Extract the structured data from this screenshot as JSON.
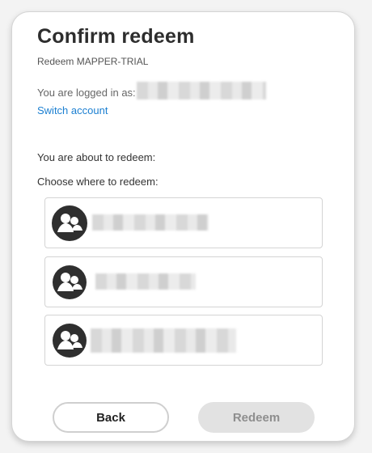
{
  "dialog": {
    "title": "Confirm redeem",
    "subtitle": "Redeem MAPPER-TRIAL"
  },
  "account": {
    "logged_in_label": "You are logged in as:",
    "switch_label": "Switch account"
  },
  "redeem": {
    "about_label": "You are about to redeem:",
    "choose_label": "Choose where to redeem:",
    "options": [
      {
        "icon": "group-avatar-icon"
      },
      {
        "icon": "group-avatar-icon"
      },
      {
        "icon": "group-avatar-icon"
      }
    ]
  },
  "actions": {
    "back_label": "Back",
    "redeem_label": "Redeem"
  },
  "colors": {
    "link": "#1b7fd1",
    "disabled_button_bg": "#e2e2e2",
    "disabled_button_text": "#8e8e8e"
  }
}
